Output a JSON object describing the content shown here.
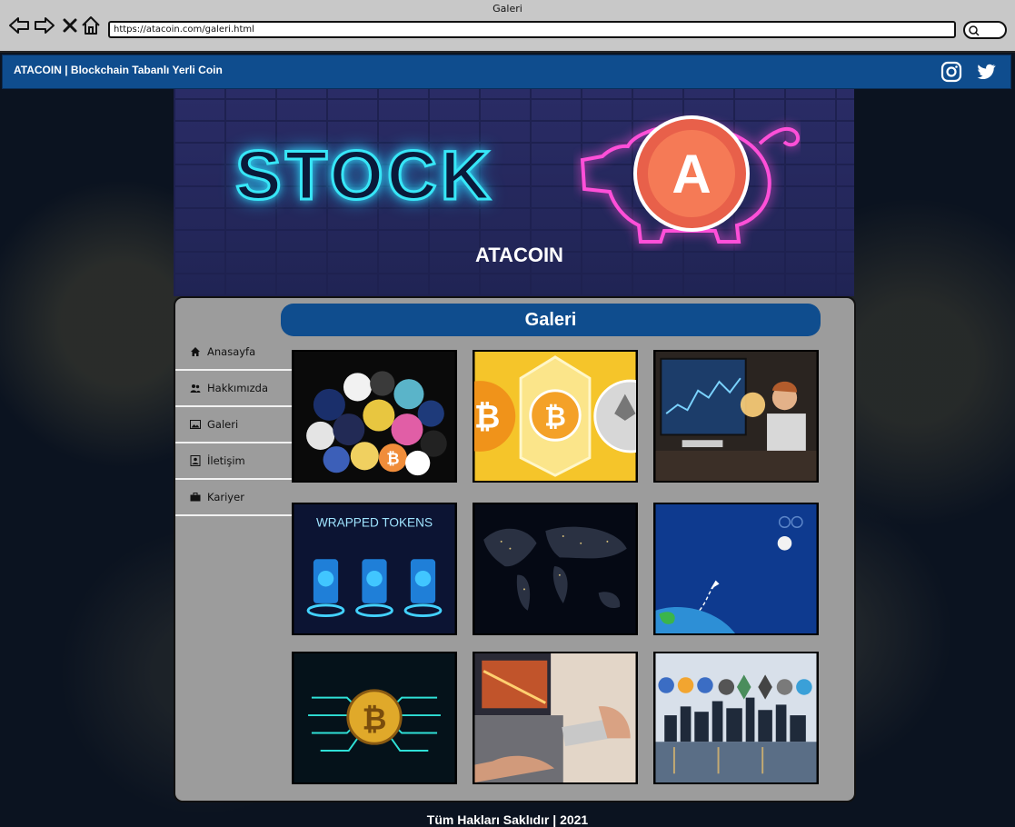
{
  "window": {
    "title": "Galeri",
    "url": "https://atacoin.com/galeri.html"
  },
  "navbar": {
    "brand": "ATACOIN | Blockchain Tabanlı Yerli Coin",
    "social": [
      {
        "icon": "instagram-icon"
      },
      {
        "icon": "twitter-icon"
      }
    ]
  },
  "hero": {
    "neon_text": "STOCK",
    "coin_letter": "A",
    "site_name": "ATACOIN"
  },
  "page": {
    "heading": "Galeri"
  },
  "sidebar": {
    "items": [
      {
        "label": "Anasayfa",
        "icon": "home-icon"
      },
      {
        "label": "Hakkımızda",
        "icon": "users-icon"
      },
      {
        "label": "Galeri",
        "icon": "image-icon"
      },
      {
        "label": "İletişim",
        "icon": "contact-card-icon"
      },
      {
        "label": "Kariyer",
        "icon": "briefcase-icon"
      }
    ]
  },
  "gallery": {
    "items": [
      {
        "subject": "crypto-coin-pile"
      },
      {
        "subject": "bitcoin-ethereum-coins"
      },
      {
        "subject": "trader-at-monitor"
      },
      {
        "subject": "wrapped-tokens",
        "caption": "WRAPPED TOKENS"
      },
      {
        "subject": "world-map-night"
      },
      {
        "subject": "rocket-launch-blue"
      },
      {
        "subject": "bitcoin-circuit"
      },
      {
        "subject": "laptop-pen-tablet"
      },
      {
        "subject": "crypto-city-skyline"
      }
    ]
  },
  "footer": {
    "text": "Tüm Hakları Saklıdır | 2021"
  },
  "colors": {
    "primary": "#0f4d8e",
    "panel": "#9c9c9c",
    "neon_cyan": "#37e6f7",
    "neon_pink": "#ff4fd8",
    "coin_orange": "#f36f4f"
  }
}
